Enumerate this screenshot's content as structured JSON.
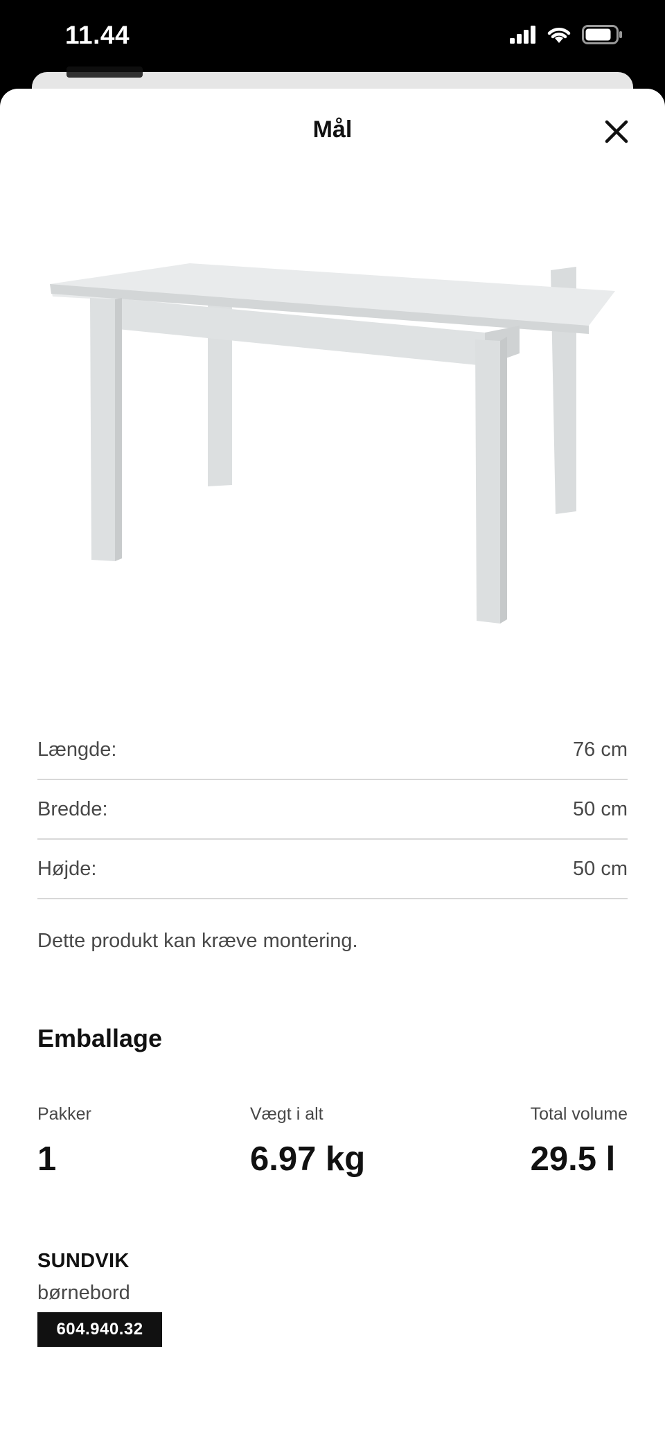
{
  "status_bar": {
    "time": "11.44"
  },
  "sheet": {
    "title": "Mål"
  },
  "dimensions": [
    {
      "label": "Længde:",
      "value": "76 cm"
    },
    {
      "label": "Bredde:",
      "value": "50 cm"
    },
    {
      "label": "Højde:",
      "value": "50 cm"
    }
  ],
  "assembly_note": "Dette produkt kan kræve montering.",
  "packaging": {
    "title": "Emballage",
    "packages_label": "Pakker",
    "packages_value": "1",
    "weight_label": "Vægt i alt",
    "weight_value": "6.97 kg",
    "volume_label": "Total volume",
    "volume_value": "29.5 l"
  },
  "product": {
    "name": "SUNDVIK",
    "description": "børnebord",
    "article_number": "604.940.32"
  },
  "icons": [
    "signal-icon",
    "wifi-icon",
    "battery-icon",
    "close-icon"
  ],
  "colors": {
    "background": "#ffffff",
    "text": "#111111",
    "secondary_text": "#484848",
    "badge_bg": "#111111"
  }
}
